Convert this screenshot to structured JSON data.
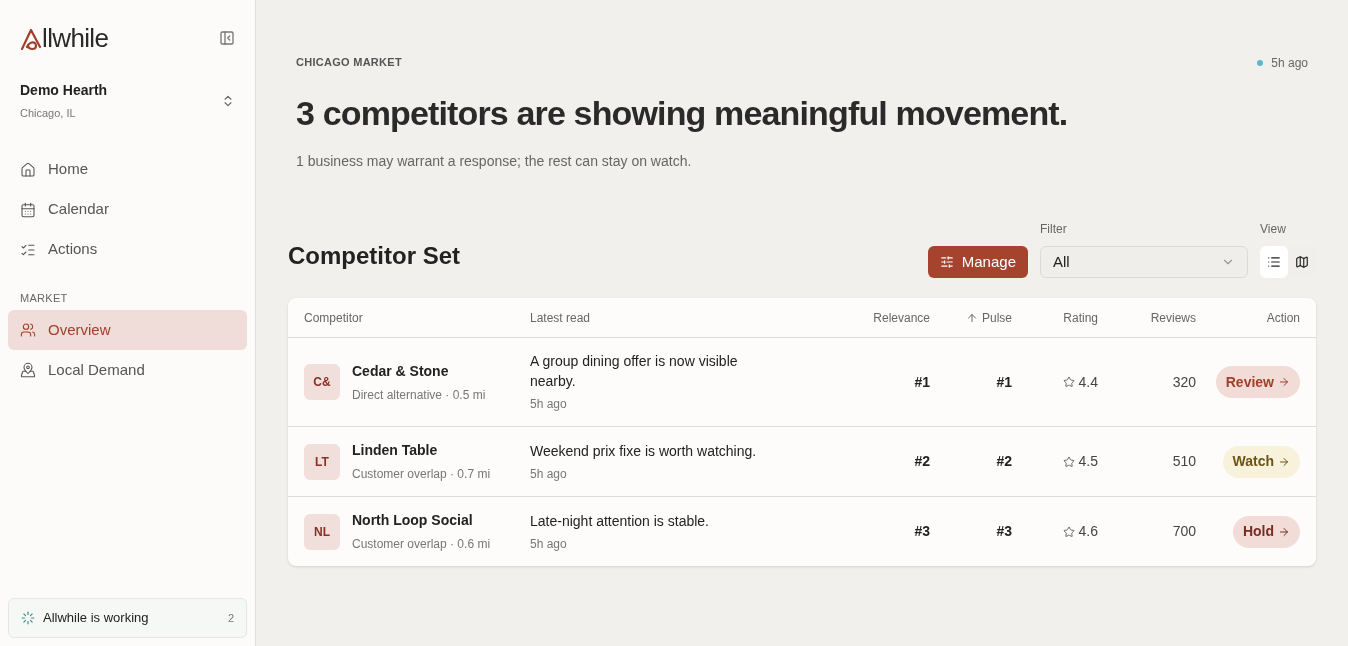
{
  "sidebar": {
    "logo_text": "llwhile",
    "workspace": {
      "name": "Demo Hearth",
      "location": "Chicago, IL"
    },
    "nav": [
      {
        "label": "Home",
        "kind": "home",
        "selected": false
      },
      {
        "label": "Calendar",
        "kind": "calendar",
        "selected": false
      },
      {
        "label": "Actions",
        "kind": "actions",
        "selected": false
      }
    ],
    "section": "MARKET",
    "market_nav": [
      {
        "label": "Overview",
        "kind": "users",
        "selected": true
      },
      {
        "label": "Local Demand",
        "kind": "pin",
        "selected": false
      }
    ],
    "status": {
      "label": "Allwhile is working",
      "count": "2"
    }
  },
  "header": {
    "eyebrow": "CHICAGO MARKET",
    "updated": "5h ago",
    "title": "3 competitors are showing meaningful movement.",
    "subtitle": "1 business may warrant a response; the rest can stay on watch."
  },
  "competitor_set": {
    "title": "Competitor Set",
    "manage": "Manage",
    "filter": {
      "label": "Filter",
      "value": "All"
    },
    "view": {
      "label": "View",
      "options": [
        {
          "kind": "list",
          "selected": true
        },
        {
          "kind": "map",
          "selected": false
        }
      ]
    },
    "columns": [
      "Competitor",
      "Latest read",
      "Relevance",
      "Pulse",
      "Rating",
      "Reviews",
      "Action"
    ],
    "rows": [
      {
        "initials": "C&",
        "name": "Cedar & Stone",
        "detail": "Direct alternative · 0.5 mi",
        "read": "A group dining offer is now visible nearby.",
        "time": "5h ago",
        "relevance": "#1",
        "pulse": "#1",
        "rating": "4.4",
        "reviews": "320",
        "action": {
          "label": "Review",
          "kind": "review"
        }
      },
      {
        "initials": "LT",
        "name": "Linden Table",
        "detail": "Customer overlap · 0.7 mi",
        "read": "Weekend prix fixe is worth watching.",
        "time": "5h ago",
        "relevance": "#2",
        "pulse": "#2",
        "rating": "4.5",
        "reviews": "510",
        "action": {
          "label": "Watch",
          "kind": "watch"
        }
      },
      {
        "initials": "NL",
        "name": "North Loop Social",
        "detail": "Customer overlap · 0.6 mi",
        "read": "Late-night attention is stable.",
        "time": "5h ago",
        "relevance": "#3",
        "pulse": "#3",
        "rating": "4.6",
        "reviews": "700",
        "action": {
          "label": "Hold",
          "kind": "hold"
        }
      }
    ]
  }
}
